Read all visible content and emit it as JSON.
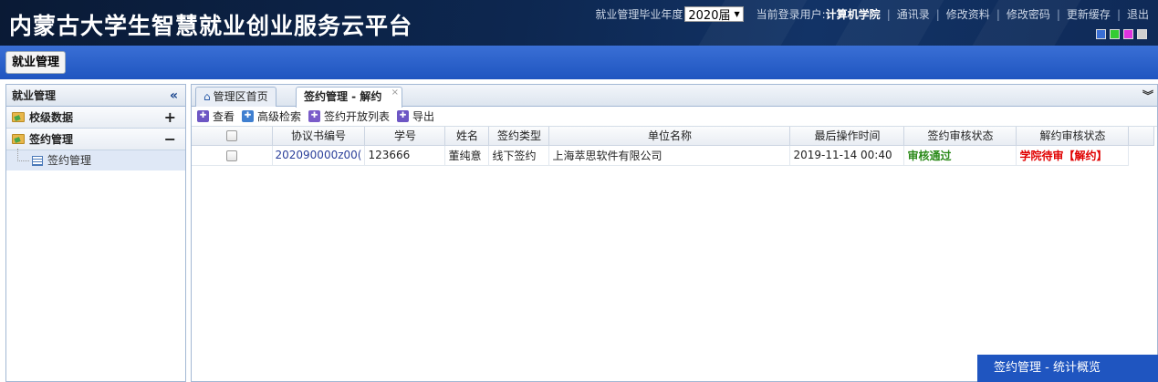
{
  "header": {
    "title": "内蒙古大学生智慧就业创业服务云平台",
    "year_label": "就业管理毕业年度",
    "year_value": "2020届",
    "user_label": "当前登录用户:",
    "user_name": "计算机学院",
    "links": [
      "通讯录",
      "修改资料",
      "修改密码",
      "更新缓存",
      "退出"
    ],
    "theme_colors": [
      "#3a6fd5",
      "#33cc33",
      "#e033e0",
      "#cfcfcf"
    ]
  },
  "module_button": "就业管理",
  "sidebar": {
    "title": "就业管理",
    "collapse_icon": "«",
    "groups": [
      {
        "label": "校级数据",
        "toggle": "+"
      },
      {
        "label": "签约管理",
        "toggle": "−"
      }
    ],
    "items": [
      {
        "label": "签约管理"
      }
    ]
  },
  "tabs": [
    {
      "label": "管理区首页"
    },
    {
      "label": "签约管理 - 解约",
      "close": "×"
    }
  ],
  "toolbar": {
    "view": "查看",
    "search": "高级检索",
    "open_list": "签约开放列表",
    "export": "导出"
  },
  "table": {
    "columns": [
      "协议书编号",
      "学号",
      "姓名",
      "签约类型",
      "单位名称",
      "最后操作时间",
      "签约审核状态",
      "解约审核状态"
    ],
    "rows": [
      [
        "202090000z00(",
        "123666",
        "董纯意",
        "线下签约",
        "上海萃思软件有限公司",
        "2019-11-14 00:40",
        "审核通过",
        "学院待审【解约】"
      ]
    ]
  },
  "status_colors": {
    "approved": "#2b8a1a",
    "pending": "#e00000"
  },
  "stat_popup": "签约管理 - 统计概览"
}
